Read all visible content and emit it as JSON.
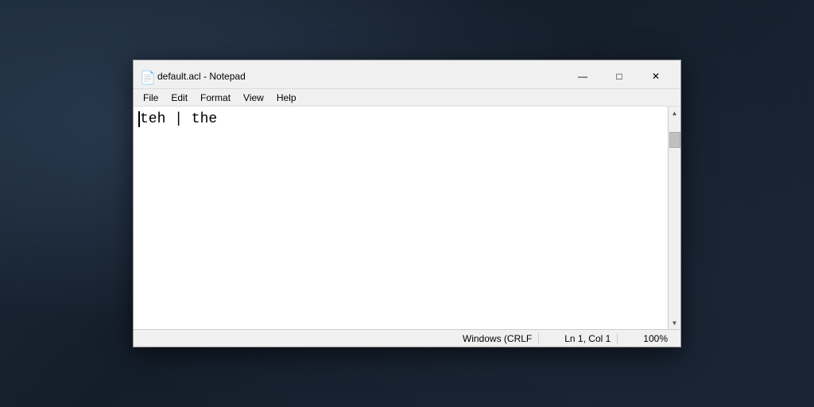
{
  "window": {
    "title": "default.acl - Notepad",
    "icon": "📄"
  },
  "title_bar": {
    "title": "default.acl - Notepad",
    "minimize_label": "—",
    "maximize_label": "□",
    "close_label": "✕"
  },
  "menu": {
    "items": [
      "File",
      "Edit",
      "Format",
      "View",
      "Help"
    ]
  },
  "editor": {
    "content": "teh | the"
  },
  "status_bar": {
    "encoding": "Windows (CRLF",
    "position": "Ln 1, Col 1",
    "zoom": "100%"
  }
}
